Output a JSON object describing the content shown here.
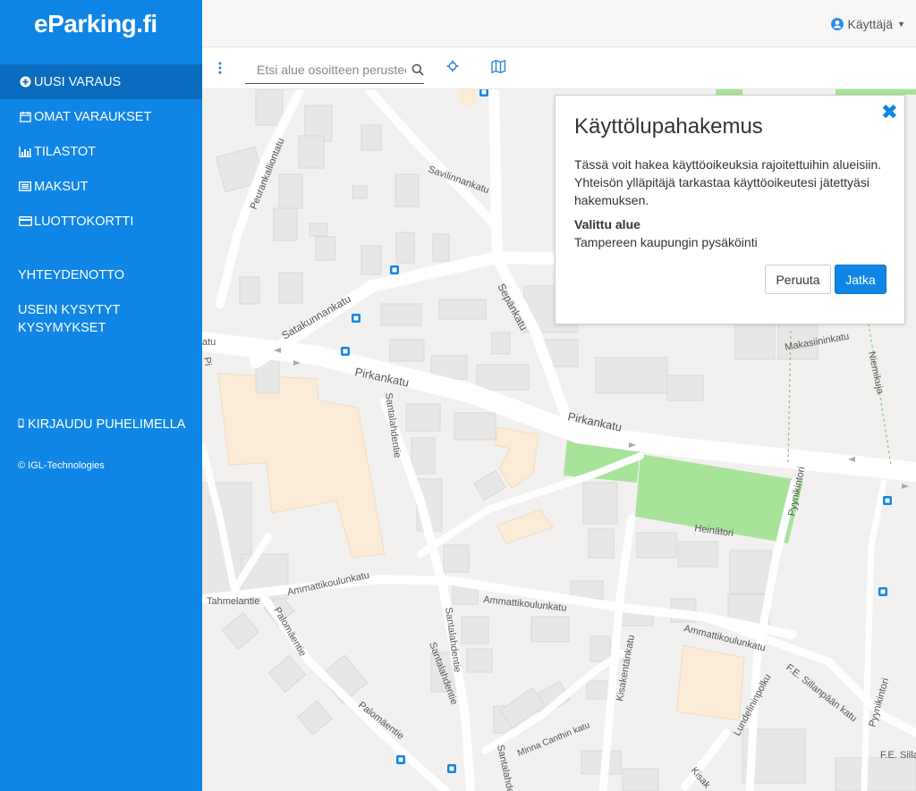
{
  "brand": {
    "logo_text": "eParking.fi"
  },
  "sidebar": {
    "items": [
      {
        "label": "UUSI VARAUS",
        "icon": "plus-circle-icon"
      },
      {
        "label": "OMAT VARAUKSET",
        "icon": "calendar-icon"
      },
      {
        "label": "TILASTOT",
        "icon": "bar-chart-icon"
      },
      {
        "label": "MAKSUT",
        "icon": "list-icon"
      },
      {
        "label": "LUOTTOKORTTI",
        "icon": "credit-card-icon"
      }
    ],
    "contact": "YHTEYDENOTTO",
    "faq": "USEIN KYSYTYT KYSYMYKSET",
    "phone_login": "KIRJAUDU PUHELIMELLA",
    "copyright": "© IGL-Technologies"
  },
  "header": {
    "user_label": "Käyttäjä"
  },
  "toolbar": {
    "search_placeholder": "Etsi alue osoitteen perusteella"
  },
  "map": {
    "streets": [
      "Peurankalliontatu",
      "Savilinnankatu",
      "Satakunnankatu",
      "Sepänkatu",
      "Pirkankatu",
      "Pirkankatu",
      "Santalahdentie",
      "Makasiininkatu",
      "Niemikuja",
      "Heinätori",
      "Pyynikintori",
      "Tahmelantie",
      "Ammattikoulunkatu",
      "Ammattikoulunkatu",
      "Ammattikoulunkatu",
      "Kisakentänkatu",
      "Palomäentie",
      "Palomäentie",
      "Santalahdentie",
      "Minna Canthin katu",
      "Lundelininpolku",
      "F.E. Sillanpään katu",
      "Pyynikintori",
      "F.E. Sillan",
      "Santalahdentie",
      "Kisak",
      "atu",
      "Pi",
      "Santalahdentie"
    ]
  },
  "dialog": {
    "title": "Käyttölupahakemus",
    "description": "Tässä voit hakea käyttöoikeuksia rajoitettuihin alueisiin. Yhteisön ylläpitäjä tarkastaa käyttöoikeutesi jätettyäsi hakemuksen.",
    "selected_label": "Valittu alue",
    "selected_value": "Tampereen kaupungin pysäköinti",
    "cancel_label": "Peruuta",
    "continue_label": "Jatka"
  },
  "colors": {
    "brand": "#0f86e6",
    "brand_dark": "#0a6cbf",
    "park": "#a8e39a",
    "building_highlight": "#fcebd6"
  }
}
